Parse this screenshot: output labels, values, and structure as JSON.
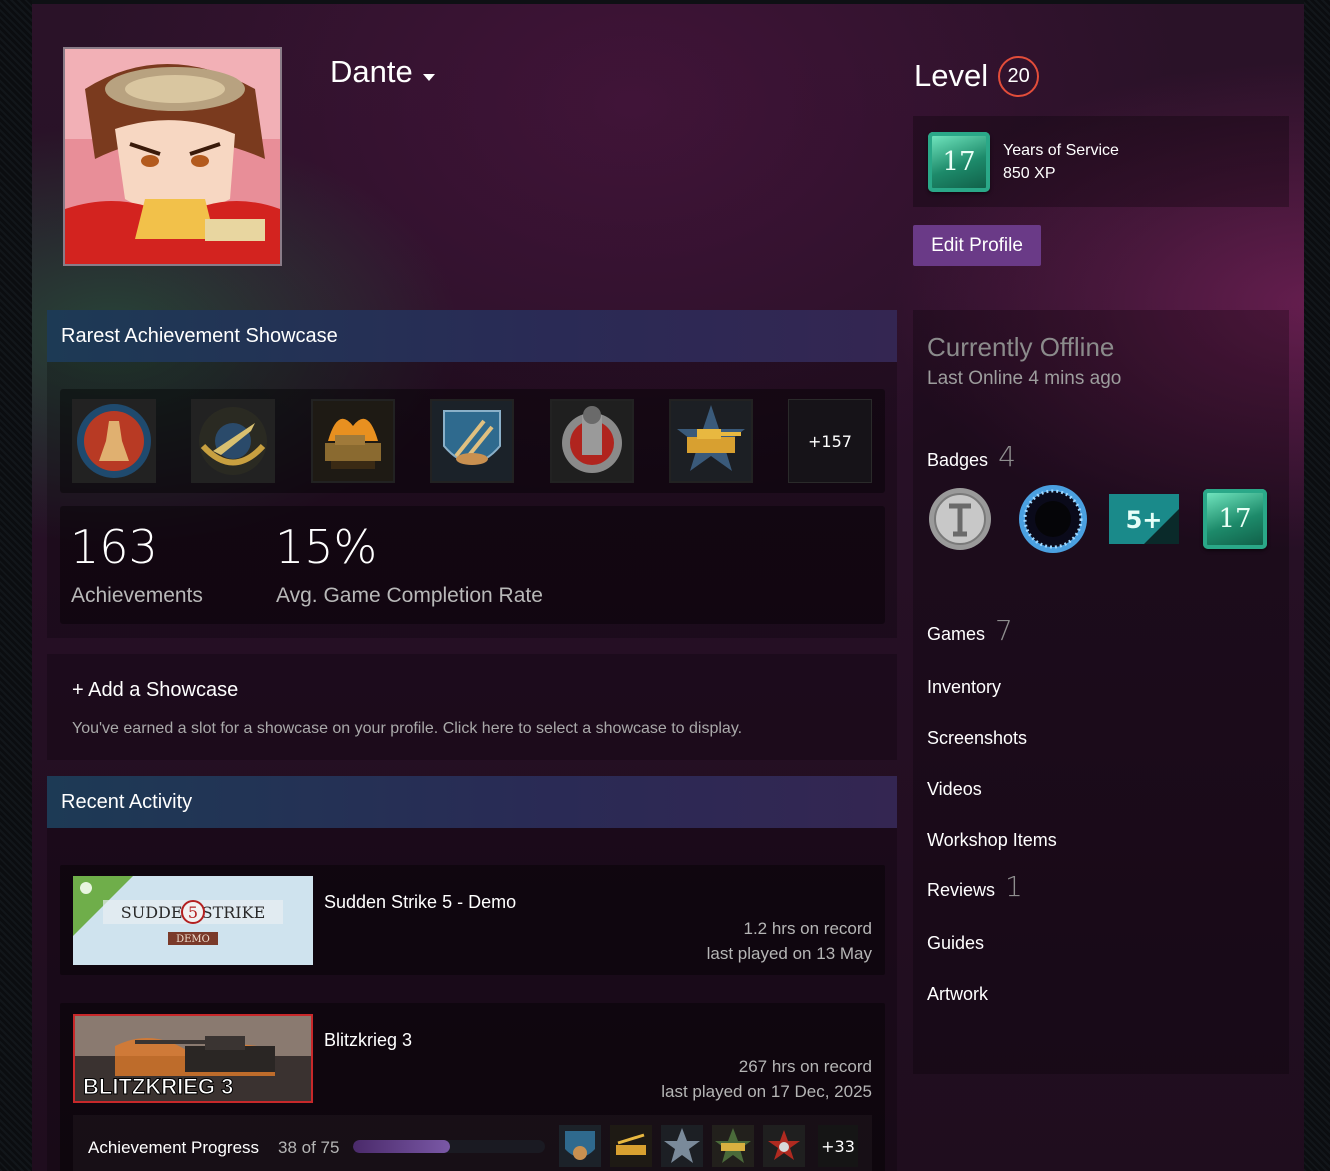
{
  "profile": {
    "name": "Dante",
    "level_label": "Level",
    "level": "20",
    "service_badge": {
      "number": "17",
      "title": "Years of Service",
      "xp": "850 XP"
    },
    "edit_label": "Edit Profile"
  },
  "showcase": {
    "title": "Rarest Achievement Showcase",
    "more": "+157",
    "achievements_count": "163",
    "achievements_label": "Achievements",
    "completion": "15%",
    "completion_label": "Avg. Game Completion Rate"
  },
  "add_showcase": {
    "title": "+ Add a Showcase",
    "desc": "You've earned a slot for a showcase on your profile. Click here to select a showcase to display."
  },
  "recent": {
    "title": "Recent Activity",
    "games": [
      {
        "name": "Sudden Strike 5 - Demo",
        "hours": "1.2 hrs on record",
        "last": "last played on 13 May",
        "cap_title": "SUDDEN STRIKE",
        "cap_num": "5",
        "cap_sub": "DEMO"
      },
      {
        "name": "Blitzkrieg 3",
        "hours": "267 hrs on record",
        "last": "last played on 17 Dec, 2025",
        "cap_title": "BLITZKRIEG 3"
      }
    ],
    "progress": {
      "label": "Achievement Progress",
      "count": "38 of 75",
      "unlocked": 38,
      "total": 75,
      "more": "+33"
    }
  },
  "sidebar": {
    "status": "Currently Offline",
    "last_online": "Last Online 4 mins ago",
    "badges_label": "Badges",
    "badges_count": "4",
    "badge_5plus": "5+",
    "badge_17": "17",
    "games_label": "Games",
    "games_count": "7",
    "inventory": "Inventory",
    "screenshots": "Screenshots",
    "videos": "Videos",
    "workshop": "Workshop Items",
    "reviews_label": "Reviews",
    "reviews_count": "1",
    "guides": "Guides",
    "artwork": "Artwork"
  },
  "colors": {
    "accent": "#6a3a87",
    "level_ring": "#e24d3a",
    "badge_green": "#1d8a6a"
  }
}
